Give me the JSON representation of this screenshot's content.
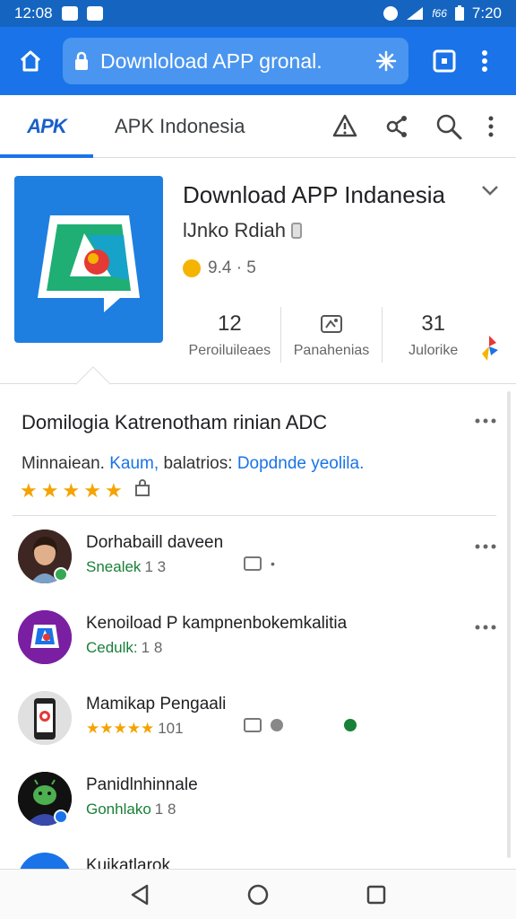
{
  "status_bar": {
    "time_left": "12:08",
    "network_label": "f66",
    "time_right": "7:20"
  },
  "browser": {
    "url_text": "Downloload APP gronal."
  },
  "site_nav": {
    "logo_text": "APK",
    "title": "APK Indonesia"
  },
  "app": {
    "title": "Download APP Indanesia",
    "developer": "lJnko Rdiah",
    "rating": "9.4 · 5",
    "stats": [
      {
        "value": "12",
        "label": "Peroiluileaes"
      },
      {
        "value": "",
        "label": "Panahenias"
      },
      {
        "value": "31",
        "label": "Julorike"
      }
    ]
  },
  "description": {
    "title": "Domilogia Katrenotham rinian ADC",
    "text_plain": "Minnaiean.",
    "text_link1": "Kaum,",
    "text_plain2": "balatrios:",
    "text_link2": "Dopdnde yeolila.",
    "stars": 5
  },
  "list": [
    {
      "title": "Dorhabaill daveen",
      "sub": "Snealek",
      "num": "1 3",
      "has_meta": true,
      "badge": "#34a853"
    },
    {
      "title": "Kenoiload P kampnenbokemkalitia",
      "sub": "Cedulk:",
      "num": "1 8",
      "has_meta": false,
      "badge": ""
    },
    {
      "title": "Mamikap Pengaali",
      "sub": "★★★★★",
      "num": "101",
      "has_meta": true,
      "badge": ""
    },
    {
      "title": "Panidlnhinnale",
      "sub": "Gonhlako",
      "num": "1 8",
      "has_meta": false,
      "badge": "#1a73e8"
    },
    {
      "title": "Kuikatlarok",
      "sub": "",
      "num": "",
      "has_meta": false,
      "badge": ""
    }
  ],
  "colors": {
    "primary": "#1a73e8",
    "status": "#1565c0",
    "green": "#188038",
    "star": "#f4a300"
  }
}
